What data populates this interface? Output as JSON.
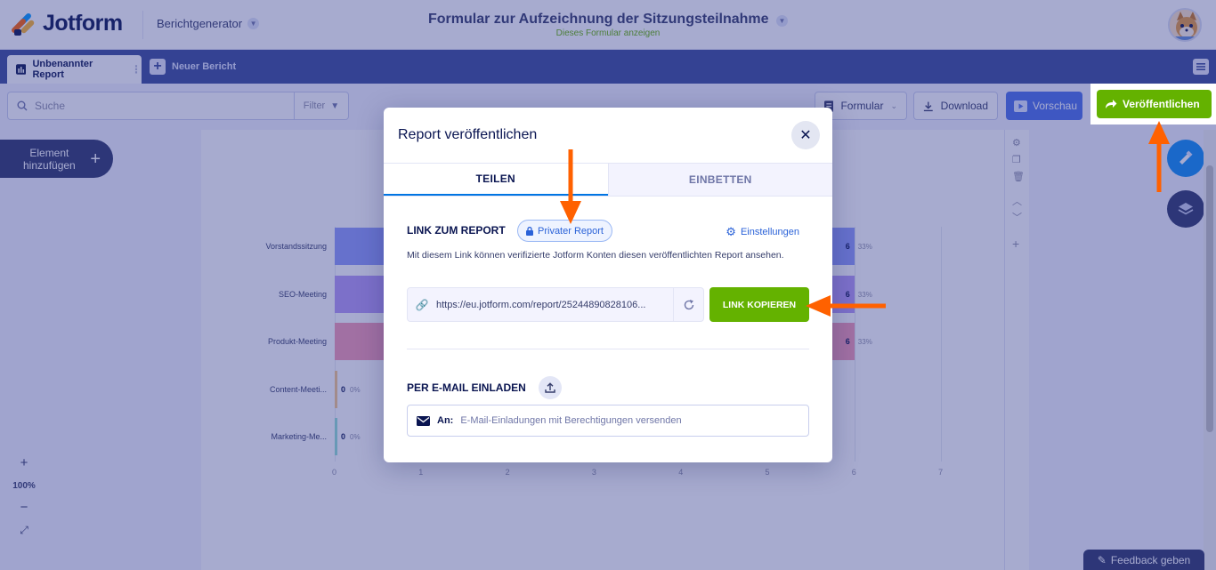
{
  "header": {
    "logo_text": "Jotform",
    "product": "Berichtgenerator",
    "form_title": "Formular zur Aufzeichnung der Sitzungsteilnahme",
    "form_subtitle": "Dieses Formular anzeigen"
  },
  "tabs": {
    "active": "Unbenannter Report",
    "new": "Neuer Bericht"
  },
  "toolbar": {
    "search_placeholder": "Suche",
    "filter": "Filter",
    "form_btn": "Formular",
    "download_btn": "Download",
    "preview_btn": "Vorschau",
    "publish_btn": "Veröffentlichen"
  },
  "canvas": {
    "add_element": [
      "Element",
      "hinzufügen"
    ],
    "zoom": "100%",
    "feedback": "Feedback geben"
  },
  "chart_data": {
    "type": "bar",
    "orientation": "horizontal",
    "categories": [
      "Vorstandssitzung",
      "SEO-Meeting",
      "Produkt-Meeting",
      "Content-Meeti...",
      "Marketing-Me..."
    ],
    "values": [
      6,
      6,
      6,
      0,
      0
    ],
    "percent_labels": [
      "33%",
      "33%",
      "33%",
      "0%",
      "0%"
    ],
    "colors": [
      "#8f9bfa",
      "#b69af5",
      "#f49ab4",
      "#f7c98a",
      "#93e0d4"
    ],
    "x_ticks": [
      "0",
      "1",
      "2",
      "3",
      "4",
      "5",
      "6",
      "7"
    ],
    "xlim": [
      0,
      7
    ]
  },
  "modal": {
    "title": "Report veröffentlichen",
    "tab_share": "TEILEN",
    "tab_embed": "EINBETTEN",
    "link_heading": "LINK ZUM REPORT",
    "private_badge": "Privater Report",
    "settings": "Einstellungen",
    "description": "Mit diesem Link können verifizierte Jotform Konten diesen veröffentlichten Report ansehen.",
    "link_url": "https://eu.jotform.com/report/25244890828106...",
    "copy_btn": "LINK KOPIEREN",
    "email_heading": "PER E-MAIL EINLADEN",
    "email_to": "An:",
    "email_placeholder": "E-Mail-Einladungen mit Berechtigungen versenden"
  },
  "colors": {
    "accent_green": "#64b200",
    "arrow_orange": "#ff6100",
    "navy": "#0a1551",
    "tabbar_blue": "#3a4a98"
  }
}
